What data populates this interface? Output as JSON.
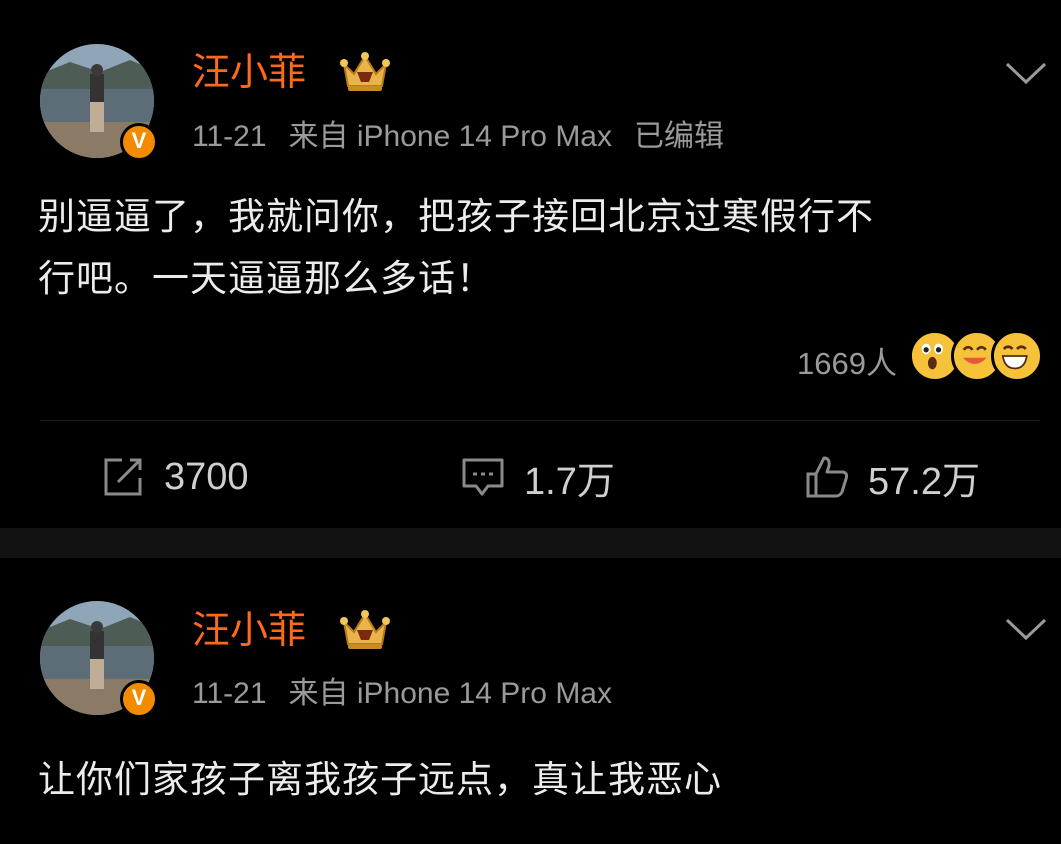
{
  "posts": [
    {
      "username": "汪小菲",
      "date": "11-21",
      "source": "来自 iPhone 14 Pro Max",
      "edited": "已编辑",
      "text_line1": "别逼逼了，我就问你，把孩子接回北京过寒假行不",
      "text_line2": "行吧。一天逼逼那么多话！",
      "reaction_count": "1669人",
      "reposts": "3700",
      "comments": "1.7万",
      "likes": "57.2万"
    },
    {
      "username": "汪小菲",
      "date": "11-21",
      "source": "来自 iPhone 14 Pro Max",
      "text_line1": "让你们家孩子离我孩子远点，真让我恶心"
    }
  ],
  "icons": {
    "verified": "v-verified-icon",
    "crown": "crown-badge-icon",
    "more": "chevron-down-icon",
    "repost": "repost-icon",
    "comment": "comment-icon",
    "like": "thumbs-up-icon"
  },
  "verified_badge_letter": "V",
  "colors": {
    "background": "#000000",
    "username": "#ff6a1a",
    "verified": "#f28b00",
    "meta_text": "#9a9a9a",
    "body_text": "#ececec",
    "separator": "#121212"
  }
}
